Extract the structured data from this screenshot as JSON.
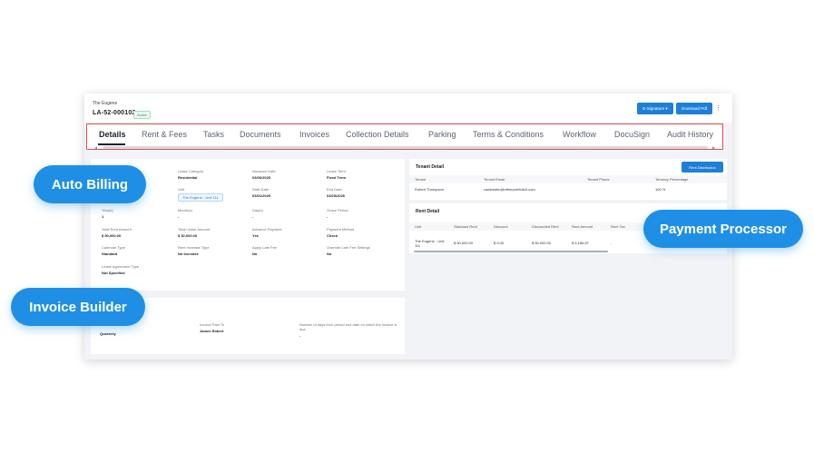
{
  "header": {
    "property": "The Eugene",
    "lease_id": "LA-52-000102",
    "status": "Active",
    "esign_label": "E-Signature ▾",
    "download_label": "Download Pdf",
    "more": "⋮"
  },
  "tabs": [
    "Details",
    "Rent & Fees",
    "Tasks",
    "Documents",
    "Invoices",
    "Collection Details",
    "Parking",
    "Terms & Conditions",
    "Workflow",
    "DocuSign",
    "Audit History"
  ],
  "details": {
    "lease_category_label": "Lease Category",
    "lease_category": "Residential",
    "issuance_date_label": "Issuance Date",
    "issuance_date": "03/06/2025",
    "lease_term_label": "Lease Term",
    "lease_term": "Fixed Term",
    "unit_label": "Unit",
    "unit": "The Eugene - Unit 111",
    "start_date_label": "Start Date",
    "start_date": "03/01/2025",
    "end_date_label": "End Date",
    "end_date": "03/29/2026",
    "years_label": "Year(s)",
    "years": "1",
    "months_label": "Month(s)",
    "months": "-",
    "days_label": "Day(s)",
    "days": "-",
    "grace_label": "Grace Period",
    "grace": "-",
    "total_rent_label": "Total Rent Amount",
    "total_rent": "$ 50,000.00",
    "total_lease_label": "Total Lease Amount",
    "total_lease": "$ 52,000.00",
    "advance_label": "Advance Payment",
    "advance": "Yes",
    "payment_method_label": "Payment Method",
    "payment_method": "Check",
    "calendar_label": "Calendar Type",
    "calendar": "Standard",
    "rent_increase_label": "Rent Increase Type",
    "rent_increase": "No Increase",
    "late_fee_label": "Apply Late Fee",
    "late_fee": "No",
    "override_label": "Override Late Fee Settings",
    "override": "No",
    "agreement_label": "Lease Agreement Type",
    "agreement": "Not Specified"
  },
  "invoice": {
    "frequency": "Quarterly",
    "paid_to_label": "Invoice Paid To",
    "paid_to": "James Robert",
    "days_label": "Number of days from period end date on which the invoice is due",
    "days": "-"
  },
  "tenant": {
    "title": "Tenant Detail",
    "button": "Rent Distribution",
    "headers": [
      "Tenant",
      "Tenant Email",
      "Tenant Phone",
      "Tenancy Percentage"
    ],
    "row": [
      "Robert Thompson",
      "cadsrealm@otherportfolio3.com",
      "",
      "100 %"
    ]
  },
  "rent": {
    "title": "Rent Detail",
    "headers": [
      "Unit",
      "Standard Rent",
      "Discount",
      "Discounted Rent",
      "Rent Amount",
      "Rent Tax"
    ],
    "row": [
      "The Eugene - Unit 111",
      "$ 50,000.00",
      "$ 0.00",
      "$ 50,000.00",
      "$ 4,166.67",
      "-"
    ]
  },
  "callouts": {
    "auto_billing": "Auto Billing",
    "invoice_builder": "Invoice Builder",
    "payment_processor": "Payment Processor"
  },
  "colors": {
    "accent": "#1f8fe6",
    "highlight_border": "#e64c4c"
  }
}
